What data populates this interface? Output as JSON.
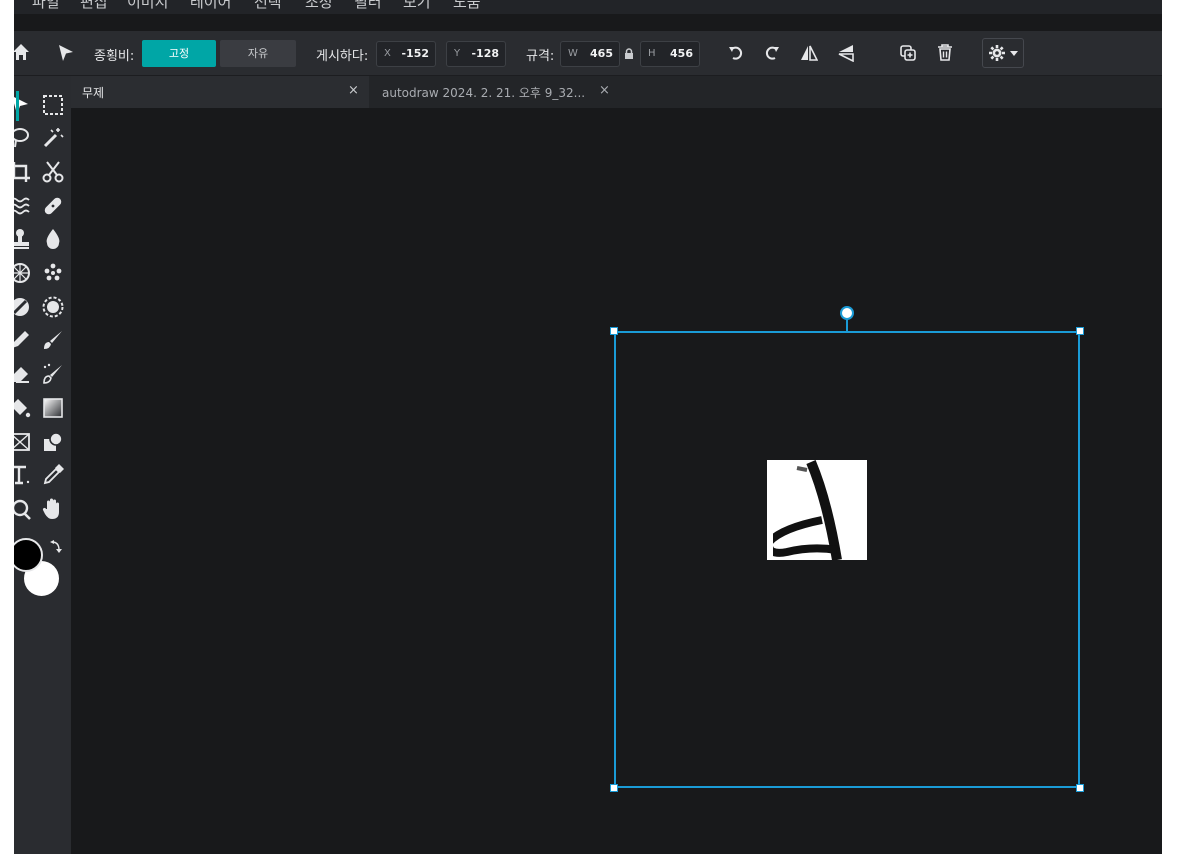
{
  "menu": {
    "items": [
      "파일",
      "편집",
      "이미지",
      "레이어",
      "선택",
      "조정",
      "필터",
      "보기",
      "도움"
    ]
  },
  "toolbar": {
    "aspect_label": "종횡비:",
    "fixed_label": "고정",
    "free_label": "자유",
    "position_label": "게시하다:",
    "x_label": "X",
    "x_value": "-152",
    "y_label": "Y",
    "y_value": "-128",
    "size_label": "규격:",
    "w_label": "W",
    "w_value": "465",
    "h_label": "H",
    "h_value": "456"
  },
  "tabs": [
    {
      "label": "무제",
      "close": "×"
    },
    {
      "label": "autodraw 2024. 2. 21. 오후 9_32...",
      "close": "×"
    }
  ],
  "colors": {
    "accent": "#00a6a6",
    "selection": "#1a9bd7",
    "foreground": "#000000",
    "background": "#ffffff"
  }
}
